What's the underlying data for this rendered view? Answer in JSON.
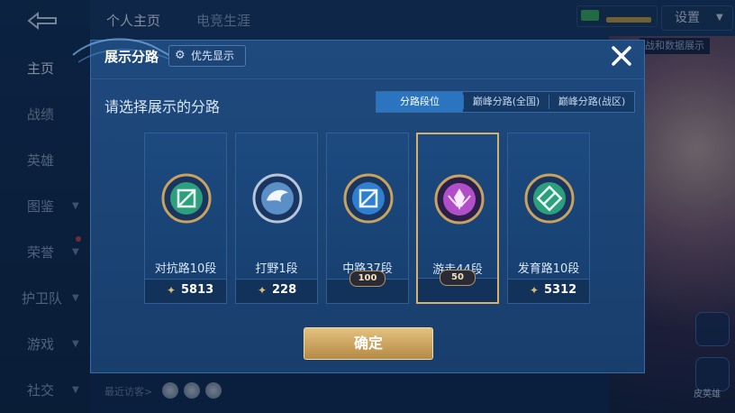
{
  "topbar": {
    "tabs": [
      "个人主页",
      "电竞生涯"
    ],
    "settings_label": "设置",
    "data_display_tag": "战和数据展示"
  },
  "sidebar": {
    "items": [
      {
        "label": "主页"
      },
      {
        "label": "战绩"
      },
      {
        "label": "英雄"
      },
      {
        "label": "图鉴"
      },
      {
        "label": "荣誉"
      },
      {
        "label": "护卫队"
      },
      {
        "label": "游戏"
      },
      {
        "label": "社交"
      }
    ]
  },
  "footer": {
    "recent_visitors": "最近访客>"
  },
  "right_buttons": [
    "",
    "皮英雄"
  ],
  "dialog": {
    "title": "展示分路",
    "priority_button": "优先显示",
    "subtitle": "请选择展示的分路",
    "tabs": [
      "分路段位",
      "巅峰分路(全国)",
      "巅峰分路(战区)"
    ],
    "active_tab": 0,
    "cards": [
      {
        "label": "对抗路10段",
        "score": "5813",
        "badge": "",
        "icon": "clash-lane-icon",
        "color": "#2e9f7c"
      },
      {
        "label": "打野1段",
        "score": "228",
        "badge": "",
        "icon": "jungle-icon",
        "color": "#5a8fc7"
      },
      {
        "label": "中路37段",
        "score": "",
        "badge": "100",
        "icon": "mid-lane-icon",
        "color": "#2f7fd1"
      },
      {
        "label": "游走44段",
        "score": "",
        "badge": "50",
        "icon": "roam-icon",
        "color": "#b14fc8",
        "selected": true
      },
      {
        "label": "发育路10段",
        "score": "5312",
        "badge": "",
        "icon": "farm-lane-icon",
        "color": "#2e9f7c"
      }
    ],
    "confirm_label": "确定"
  }
}
